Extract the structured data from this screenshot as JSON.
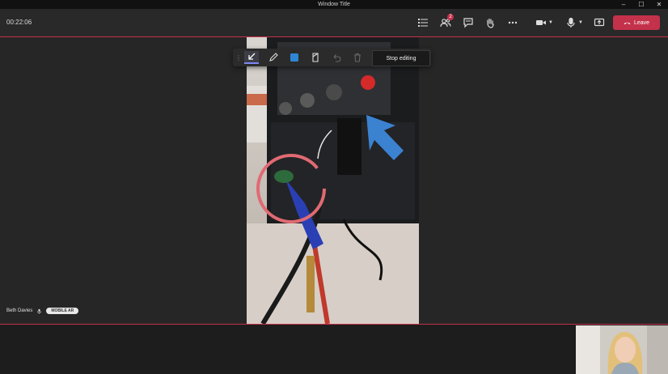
{
  "window": {
    "title": "Window Title"
  },
  "topbar": {
    "timer": "00:22:06",
    "notification_count": "2",
    "leave_label": "Leave"
  },
  "toolbar": {
    "stop_editing_label": "Stop editing"
  },
  "participant": {
    "name": "Beth Davies",
    "badge": "MOBILE AR"
  },
  "colors": {
    "accent_red": "#c4314b",
    "annotation_circle": "#e06a73",
    "annotation_arrow": "#3b82d1",
    "toolbar_highlight": "#7f85f5"
  },
  "icons": [
    "participants-list-icon",
    "people-icon",
    "chat-icon",
    "raise-hand-icon",
    "more-options-icon",
    "camera-icon",
    "microphone-icon",
    "share-screen-icon",
    "phone-hangup-icon",
    "arrow-tool-icon",
    "pen-tool-icon",
    "color-square-icon",
    "eraser-icon",
    "undo-icon",
    "trash-icon",
    "mic-small-icon",
    "minimize-icon",
    "maximize-icon",
    "close-icon"
  ]
}
